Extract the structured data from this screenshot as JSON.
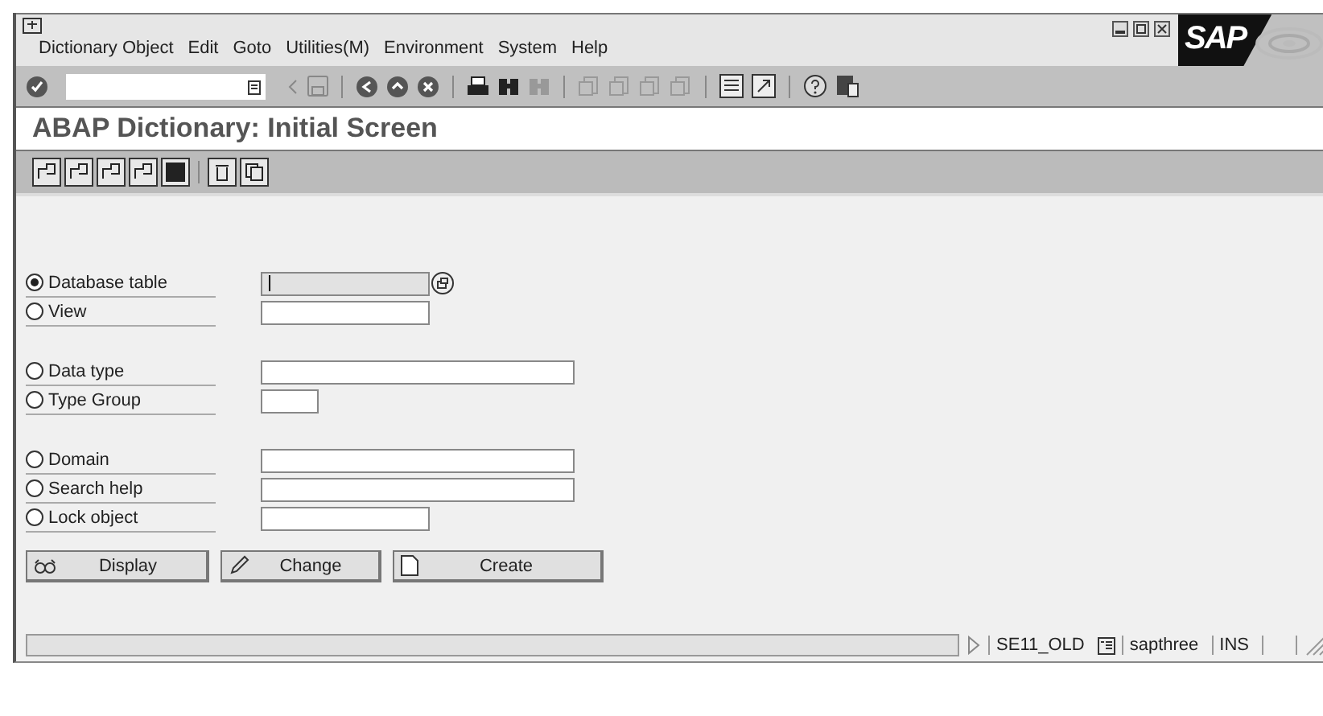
{
  "menu": [
    {
      "label": "Dictionary Object"
    },
    {
      "label": "Edit"
    },
    {
      "label": "Goto"
    },
    {
      "label": "Utilities(M)"
    },
    {
      "label": "Environment"
    },
    {
      "label": "System"
    },
    {
      "label": "Help"
    }
  ],
  "logo": "SAP",
  "title": "ABAP Dictionary: Initial Screen",
  "option_groups": [
    [
      {
        "label": "Database table",
        "selected": true,
        "value_help": true
      },
      {
        "label": "View",
        "selected": false,
        "value_help": false
      }
    ],
    [
      {
        "label": "Data type",
        "selected": false,
        "value_help": false
      },
      {
        "label": "Type Group",
        "selected": false,
        "value_help": false
      }
    ],
    [
      {
        "label": "Domain",
        "selected": false,
        "value_help": false
      },
      {
        "label": "Search help",
        "selected": false,
        "value_help": false
      },
      {
        "label": "Lock object",
        "selected": false,
        "value_help": false
      }
    ]
  ],
  "buttons": [
    {
      "label": "Display",
      "kind": "display"
    },
    {
      "label": "Change",
      "kind": "change"
    },
    {
      "label": "Create",
      "kind": "create"
    }
  ],
  "status_bar": {
    "transaction": "SE11_OLD",
    "server": "sapthree",
    "mode": "INS"
  }
}
